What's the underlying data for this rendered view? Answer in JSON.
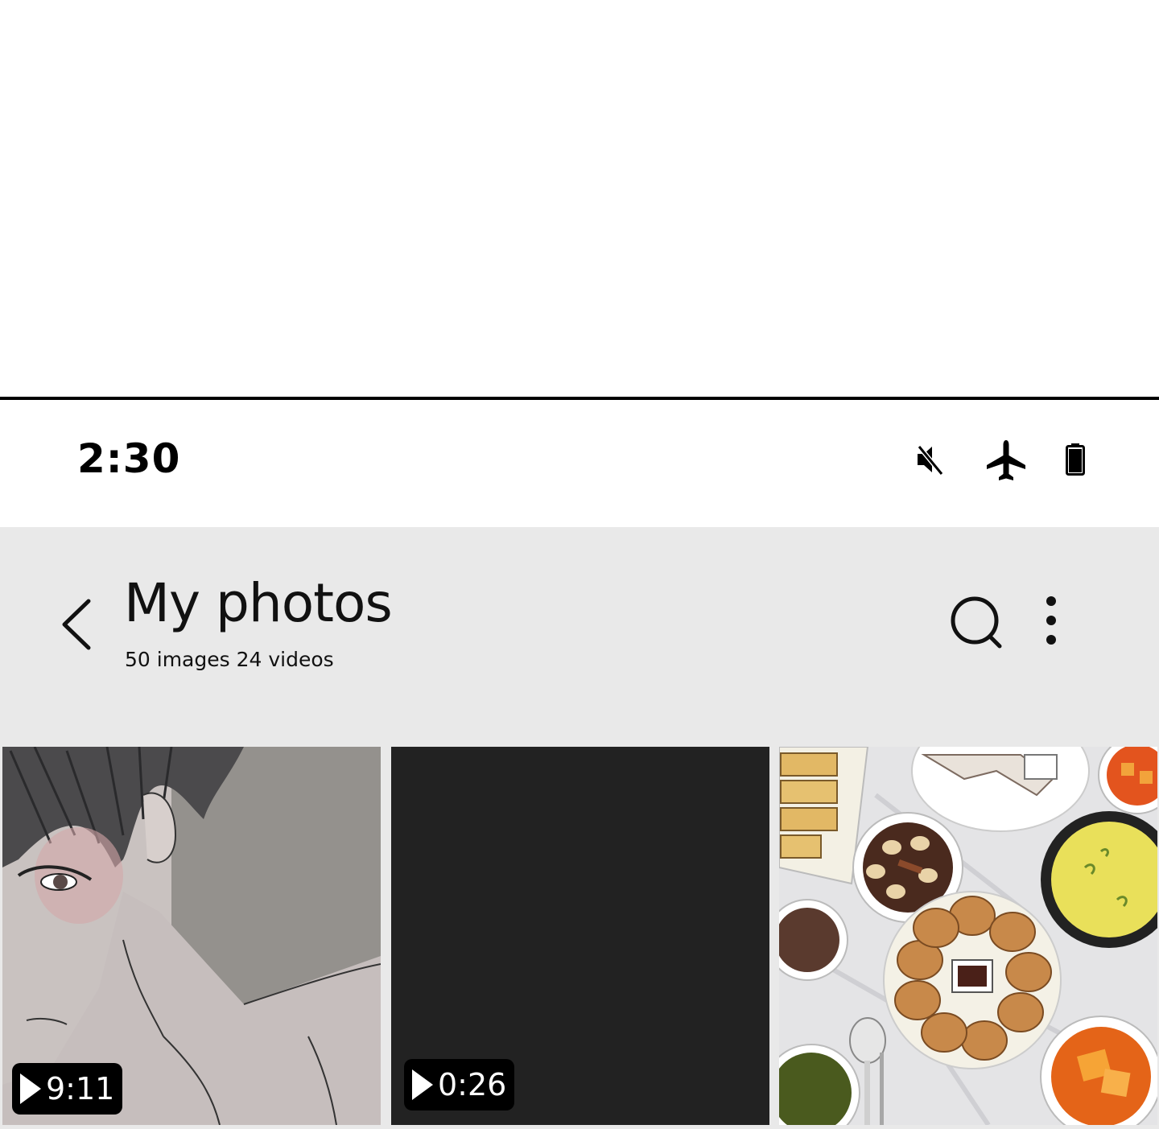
{
  "status_bar": {
    "time": "2:30",
    "icons": [
      "mute-icon",
      "airplane-mode-icon",
      "battery-icon"
    ]
  },
  "header": {
    "title": "My photos",
    "subtitle": "50 images 24 videos",
    "back_icon": "chevron-left-icon",
    "search_icon": "search-icon",
    "more_icon": "more-vertical-icon"
  },
  "grid": {
    "items": [
      {
        "type": "video",
        "duration": "9:11",
        "subject": "manga-style illustration of a blushing dark-haired man"
      },
      {
        "type": "video",
        "duration": "0:26",
        "subject": "black frame"
      },
      {
        "type": "image",
        "subject": "illustrated korean food table spread"
      }
    ]
  },
  "colors": {
    "header_bg": "#e9e9e9",
    "status_bg": "#ffffff",
    "divider": "#000000",
    "badge_bg": "#000000",
    "dark_thumb": "#222222"
  }
}
